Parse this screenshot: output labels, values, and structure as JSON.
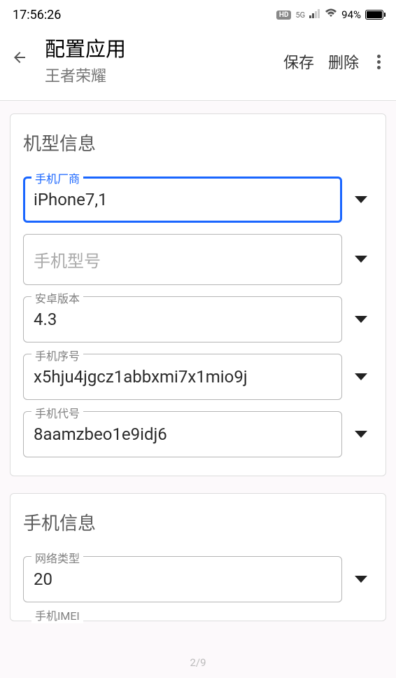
{
  "status": {
    "time": "17:56:26",
    "hd": "HD",
    "net": "5G",
    "battery_pct": "94%"
  },
  "header": {
    "title": "配置应用",
    "subtitle": "王者荣耀",
    "save": "保存",
    "delete": "删除"
  },
  "section_device": {
    "title": "机型信息",
    "fields": {
      "vendor_label": "手机厂商",
      "vendor_value": "iPhone7,1",
      "model_label": "手机型号",
      "model_value": "",
      "model_placeholder": "手机型号",
      "android_label": "安卓版本",
      "android_value": "4.3",
      "serial_label": "手机序号",
      "serial_value": "x5hju4jgcz1abbxmi7x1mio9j",
      "codename_label": "手机代号",
      "codename_value": "8aamzbeo1e9idj6"
    }
  },
  "section_phone": {
    "title": "手机信息",
    "fields": {
      "nettype_label": "网络类型",
      "nettype_value": "20",
      "imei_label": "手机IMEI"
    }
  },
  "pager": "2/9"
}
